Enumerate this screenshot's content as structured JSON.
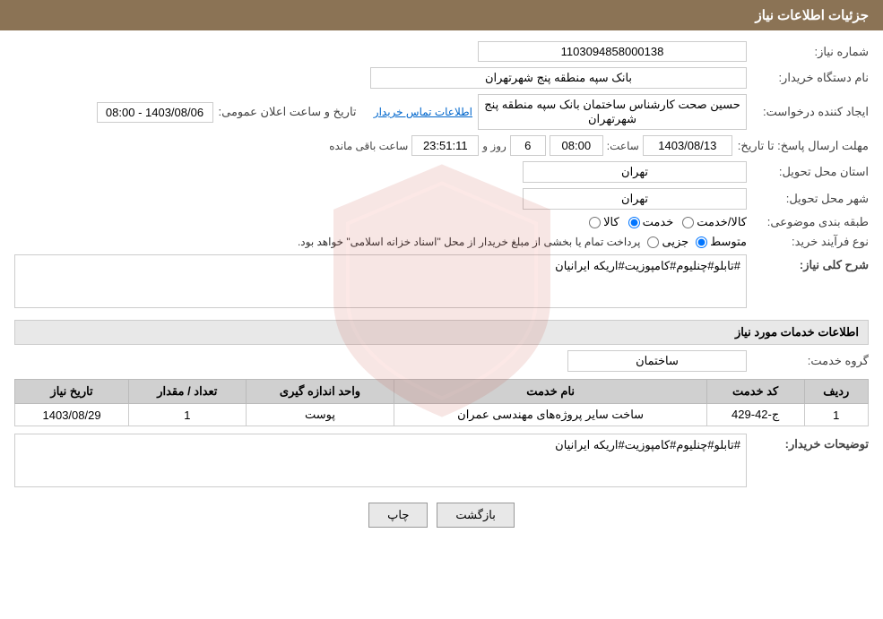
{
  "header": {
    "title": "جزئیات اطلاعات نیاز"
  },
  "fields": {
    "need_number_label": "شماره نیاز:",
    "need_number_value": "1103094858000138",
    "org_name_label": "نام دستگاه خریدار:",
    "org_name_value": "بانک سپه منطقه پنج شهرتهران",
    "announcement_date_label": "تاریخ و ساعت اعلان عمومی:",
    "announcement_date_value": "1403/08/06 - 08:00",
    "creator_label": "ایجاد کننده درخواست:",
    "creator_value": "حسین صحت کارشناس ساختمان بانک سپه منطقه پنج شهرتهران",
    "contact_link": "اطلاعات تماس خریدار",
    "send_deadline_label": "مهلت ارسال پاسخ: تا تاریخ:",
    "deadline_date_value": "1403/08/13",
    "deadline_time_label": "ساعت:",
    "deadline_time_value": "08:00",
    "deadline_days_label": "روز و",
    "deadline_days_value": "6",
    "deadline_remaining_label": "ساعت باقی مانده",
    "deadline_remaining_value": "23:51:11",
    "province_label": "استان محل تحویل:",
    "province_value": "تهران",
    "city_label": "شهر محل تحویل:",
    "city_value": "تهران",
    "category_label": "طبقه بندی موضوعی:",
    "category_options": [
      "کالا",
      "خدمت",
      "کالا/خدمت"
    ],
    "category_selected": "خدمت",
    "purchase_type_label": "نوع فرآیند خرید:",
    "purchase_type_options": [
      "جزیی",
      "متوسط"
    ],
    "purchase_type_selected": "متوسط",
    "purchase_type_note": "پرداخت تمام یا بخشی از مبلغ خریدار از محل \"اسناد خزانه اسلامی\" خواهد بود.",
    "description_label": "شرح کلی نیاز:",
    "description_value": "#تابلو#چنلیوم#کامپوزیت#اریکه ایرانیان",
    "services_section_title": "اطلاعات خدمات مورد نیاز",
    "group_service_label": "گروه خدمت:",
    "group_service_value": "ساختمان",
    "table_headers": [
      "ردیف",
      "کد خدمت",
      "نام خدمت",
      "واحد اندازه گیری",
      "تعداد / مقدار",
      "تاریخ نیاز"
    ],
    "table_rows": [
      {
        "row": "1",
        "service_code": "ج-42-429",
        "service_name": "ساخت سایر پروژه‌های مهندسی عمران",
        "unit": "پوست",
        "quantity": "1",
        "date": "1403/08/29"
      }
    ],
    "buyer_description_label": "توضیحات خریدار:",
    "buyer_description_value": "#تابلو#چنلیوم#کامپوزیت#اریکه ایرانیان",
    "btn_print": "چاپ",
    "btn_back": "بازگشت"
  }
}
